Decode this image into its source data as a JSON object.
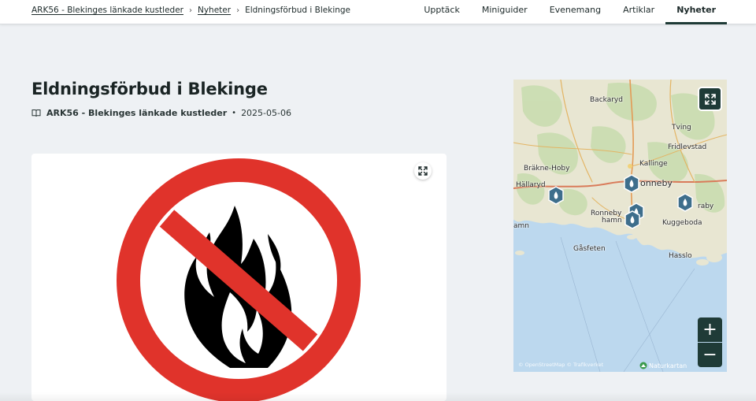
{
  "breadcrumb": {
    "items": [
      "ARK56 - Blekinges länkade kustleder",
      "Nyheter"
    ],
    "current": "Eldningsförbud i Blekinge"
  },
  "nav": {
    "tabs": [
      "Upptäck",
      "Miniguider",
      "Evenemang",
      "Artiklar",
      "Nyheter"
    ],
    "active": "Nyheter"
  },
  "article": {
    "title": "Eldningsförbud i Blekinge",
    "source": "ARK56 - Blekinges länkade kustleder",
    "separator": "•",
    "date": "2025-05-06"
  },
  "hero": {
    "image": "no-fire-sign",
    "sign_ring_color": "#e0332b",
    "flame_color": "#000000"
  },
  "map": {
    "labels": {
      "backaryd": "Backaryd",
      "tving": "Tving",
      "fridlevstad": "Fridlevstad",
      "brakne": "Bräkne-Hoby",
      "kallinge": "Kallinge",
      "hallaryd": "Hällaryd",
      "ronneby": "onneby",
      "ronneby_hamn_1": "Ronneby",
      "ronneby_hamn_2": "hamn",
      "traby": "raby",
      "kuggeboda": "Kuggeboda",
      "amn": "amn",
      "gasfeten": "Gåsfeten",
      "hasslo": "Hasslo"
    },
    "attribution": "© OpenStreetMap © Trafikverket",
    "brand": "Naturkartan",
    "zoom_in": "+",
    "zoom_out": "−",
    "water_color": "#bcd8ee",
    "land_color": "#e8e6d2"
  }
}
